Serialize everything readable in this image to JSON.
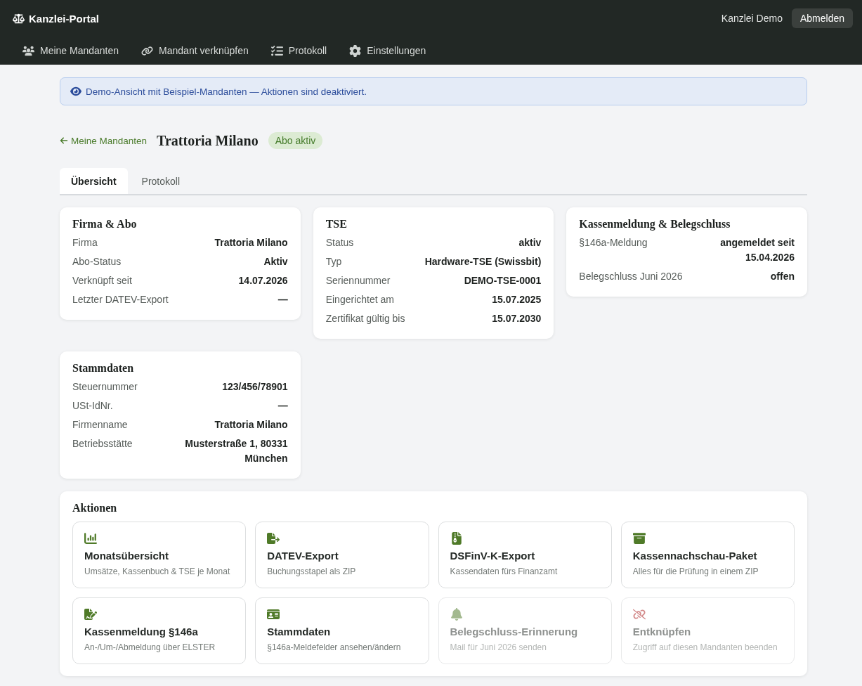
{
  "header": {
    "brand": "Kanzlei-Portal",
    "user": "Kanzlei Demo",
    "logout": "Abmelden"
  },
  "nav": [
    "Meine Mandanten",
    "Mandant verknüpfen",
    "Protokoll",
    "Einstellungen"
  ],
  "banner": {
    "text": "Demo-Ansicht mit Beispiel-Mandanten — Aktionen sind deaktiviert."
  },
  "page_header": {
    "back": "Meine Mandanten",
    "title": "Trattoria Milano",
    "badge": "Abo aktiv"
  },
  "tabs": [
    {
      "label": "Übersicht",
      "selected": true
    },
    {
      "label": "Protokoll",
      "selected": false
    }
  ],
  "cards": [
    {
      "title": "Firma & Abo",
      "rows": [
        {
          "label": "Firma",
          "value": "Trattoria Milano"
        },
        {
          "label": "Abo-Status",
          "value": "Aktiv"
        },
        {
          "label": "Verknüpft seit",
          "value": "14.07.2026"
        },
        {
          "label": "Letzter DATEV-Export",
          "value": "—"
        }
      ]
    },
    {
      "title": "TSE",
      "rows": [
        {
          "label": "Status",
          "value": "aktiv"
        },
        {
          "label": "Typ",
          "value": "Hardware-TSE (Swissbit)"
        },
        {
          "label": "Seriennummer",
          "value": "DEMO-TSE-0001"
        },
        {
          "label": "Eingerichtet am",
          "value": "15.07.2025"
        },
        {
          "label": "Zertifikat gültig bis",
          "value": "15.07.2030"
        }
      ]
    },
    {
      "title": "Kassenmeldung & Belegschluss",
      "rows": [
        {
          "label": "§146a-Meldung",
          "value": "angemeldet seit 15.04.2026"
        },
        {
          "label": "Belegschluss Juni 2026",
          "value": "offen"
        }
      ]
    },
    {
      "title": "Stammdaten",
      "rows": [
        {
          "label": "Steuernummer",
          "value": "123/456/78901"
        },
        {
          "label": "USt-IdNr.",
          "value": "—"
        },
        {
          "label": "Firmenname",
          "value": "Trattoria Milano"
        },
        {
          "label": "Betriebsstätte",
          "value": "Musterstraße 1, 80331 München"
        }
      ]
    }
  ],
  "actions": {
    "title": "Aktionen",
    "items": [
      {
        "title": "Monatsübersicht",
        "description": "Umsätze, Kassenbuch & TSE je Monat",
        "disabled": false,
        "kind": "normal"
      },
      {
        "title": "DATEV-Export",
        "description": "Buchungsstapel als ZIP",
        "disabled": false,
        "kind": "normal"
      },
      {
        "title": "DSFinV-K-Export",
        "description": "Kassendaten fürs Finanzamt",
        "disabled": false,
        "kind": "normal"
      },
      {
        "title": "Kassennachschau-Paket",
        "description": "Alles für die Prüfung in einem ZIP",
        "disabled": false,
        "kind": "normal"
      },
      {
        "title": "Kassenmeldung §146a",
        "description": "An-/Um-/Abmeldung über ELSTER",
        "disabled": false,
        "kind": "normal"
      },
      {
        "title": "Stammdaten",
        "description": "§146a-Meldefelder ansehen/ändern",
        "disabled": false,
        "kind": "normal"
      },
      {
        "title": "Belegschluss-Erinnerung",
        "description": "Mail für Juni 2026 senden",
        "disabled": true,
        "kind": "normal"
      },
      {
        "title": "Entknüpfen",
        "description": "Zugriff auf diesen Mandanten beenden",
        "disabled": true,
        "kind": "danger"
      }
    ]
  }
}
